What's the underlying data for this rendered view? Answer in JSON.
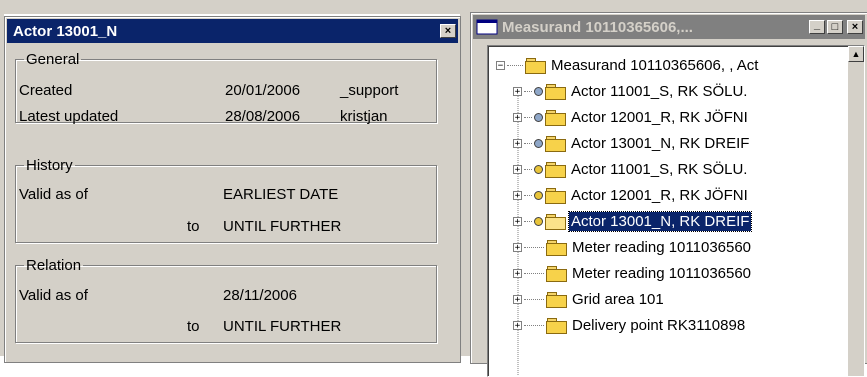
{
  "actor_window": {
    "title": "Actor 13001_N",
    "close_glyph": "×",
    "general": {
      "legend": "General",
      "created_label": "Created",
      "created_date": "20/01/2006",
      "created_by": "_support",
      "updated_label": "Latest updated",
      "updated_date": "28/08/2006",
      "updated_by": "kristjan"
    },
    "history": {
      "legend": "History",
      "valid_label": "Valid as of",
      "valid_value": "EARLIEST DATE",
      "to_label": "to",
      "to_value": "UNTIL FURTHER"
    },
    "relation": {
      "legend": "Relation",
      "valid_label": "Valid as of",
      "valid_value": "28/11/2006",
      "to_label": "to",
      "to_value": "UNTIL FURTHER"
    }
  },
  "measurand_window": {
    "title": "Measurand 10110365606,...",
    "minimize_glyph": "_",
    "maximize_glyph": "□",
    "close_glyph": "×",
    "root": {
      "label": "Measurand 10110365606, , Act",
      "expander": "−"
    },
    "items": [
      {
        "label": "Actor 11001_S, RK SÖLU.",
        "icon": "actor-folder",
        "expander": "+",
        "selected": false
      },
      {
        "label": "Actor 12001_R, RK JÖFNI",
        "icon": "actor-folder",
        "expander": "+",
        "selected": false
      },
      {
        "label": "Actor 13001_N, RK DREIF",
        "icon": "actor-folder",
        "expander": "+",
        "selected": false
      },
      {
        "label": "Actor 11001_S, RK SÖLU.",
        "icon": "actor-folder",
        "expander": "+",
        "selected": false
      },
      {
        "label": "Actor 12001_R, RK JÖFNI",
        "icon": "actor-folder",
        "expander": "+",
        "selected": false
      },
      {
        "label": "Actor 13001_N, RK DREIF",
        "icon": "actor-folder-open",
        "expander": "+",
        "selected": true
      },
      {
        "label": "Meter reading 1011036560",
        "icon": "folder",
        "expander": "+",
        "selected": false
      },
      {
        "label": "Meter reading 1011036560",
        "icon": "folder",
        "expander": "+",
        "selected": false
      },
      {
        "label": "Grid area 101",
        "icon": "folder",
        "expander": "+",
        "selected": false
      },
      {
        "label": "Delivery point RK3110898",
        "icon": "folder",
        "expander": "+",
        "selected": false
      }
    ],
    "scroll_up_glyph": "▲"
  }
}
